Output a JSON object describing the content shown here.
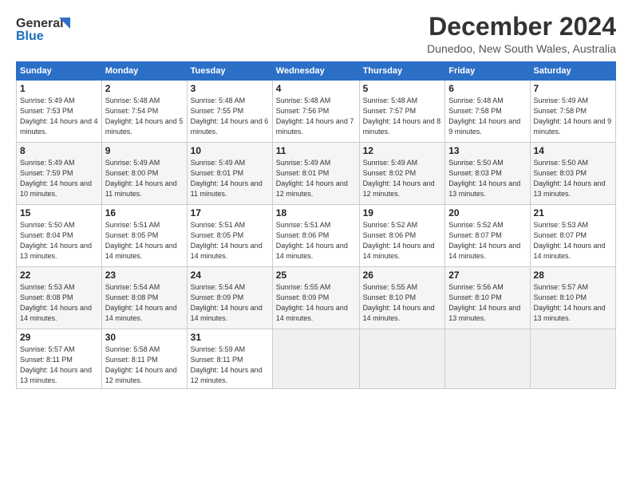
{
  "logo": {
    "line1": "General",
    "line2": "Blue"
  },
  "title": "December 2024",
  "location": "Dunedoo, New South Wales, Australia",
  "days_header": [
    "Sunday",
    "Monday",
    "Tuesday",
    "Wednesday",
    "Thursday",
    "Friday",
    "Saturday"
  ],
  "weeks": [
    [
      {
        "day": "1",
        "sunrise": "5:49 AM",
        "sunset": "7:53 PM",
        "daylight": "14 hours and 4 minutes."
      },
      {
        "day": "2",
        "sunrise": "5:48 AM",
        "sunset": "7:54 PM",
        "daylight": "14 hours and 5 minutes."
      },
      {
        "day": "3",
        "sunrise": "5:48 AM",
        "sunset": "7:55 PM",
        "daylight": "14 hours and 6 minutes."
      },
      {
        "day": "4",
        "sunrise": "5:48 AM",
        "sunset": "7:56 PM",
        "daylight": "14 hours and 7 minutes."
      },
      {
        "day": "5",
        "sunrise": "5:48 AM",
        "sunset": "7:57 PM",
        "daylight": "14 hours and 8 minutes."
      },
      {
        "day": "6",
        "sunrise": "5:48 AM",
        "sunset": "7:58 PM",
        "daylight": "14 hours and 9 minutes."
      },
      {
        "day": "7",
        "sunrise": "5:49 AM",
        "sunset": "7:58 PM",
        "daylight": "14 hours and 9 minutes."
      }
    ],
    [
      {
        "day": "8",
        "sunrise": "5:49 AM",
        "sunset": "7:59 PM",
        "daylight": "14 hours and 10 minutes."
      },
      {
        "day": "9",
        "sunrise": "5:49 AM",
        "sunset": "8:00 PM",
        "daylight": "14 hours and 11 minutes."
      },
      {
        "day": "10",
        "sunrise": "5:49 AM",
        "sunset": "8:01 PM",
        "daylight": "14 hours and 11 minutes."
      },
      {
        "day": "11",
        "sunrise": "5:49 AM",
        "sunset": "8:01 PM",
        "daylight": "14 hours and 12 minutes."
      },
      {
        "day": "12",
        "sunrise": "5:49 AM",
        "sunset": "8:02 PM",
        "daylight": "14 hours and 12 minutes."
      },
      {
        "day": "13",
        "sunrise": "5:50 AM",
        "sunset": "8:03 PM",
        "daylight": "14 hours and 13 minutes."
      },
      {
        "day": "14",
        "sunrise": "5:50 AM",
        "sunset": "8:03 PM",
        "daylight": "14 hours and 13 minutes."
      }
    ],
    [
      {
        "day": "15",
        "sunrise": "5:50 AM",
        "sunset": "8:04 PM",
        "daylight": "14 hours and 13 minutes."
      },
      {
        "day": "16",
        "sunrise": "5:51 AM",
        "sunset": "8:05 PM",
        "daylight": "14 hours and 14 minutes."
      },
      {
        "day": "17",
        "sunrise": "5:51 AM",
        "sunset": "8:05 PM",
        "daylight": "14 hours and 14 minutes."
      },
      {
        "day": "18",
        "sunrise": "5:51 AM",
        "sunset": "8:06 PM",
        "daylight": "14 hours and 14 minutes."
      },
      {
        "day": "19",
        "sunrise": "5:52 AM",
        "sunset": "8:06 PM",
        "daylight": "14 hours and 14 minutes."
      },
      {
        "day": "20",
        "sunrise": "5:52 AM",
        "sunset": "8:07 PM",
        "daylight": "14 hours and 14 minutes."
      },
      {
        "day": "21",
        "sunrise": "5:53 AM",
        "sunset": "8:07 PM",
        "daylight": "14 hours and 14 minutes."
      }
    ],
    [
      {
        "day": "22",
        "sunrise": "5:53 AM",
        "sunset": "8:08 PM",
        "daylight": "14 hours and 14 minutes."
      },
      {
        "day": "23",
        "sunrise": "5:54 AM",
        "sunset": "8:08 PM",
        "daylight": "14 hours and 14 minutes."
      },
      {
        "day": "24",
        "sunrise": "5:54 AM",
        "sunset": "8:09 PM",
        "daylight": "14 hours and 14 minutes."
      },
      {
        "day": "25",
        "sunrise": "5:55 AM",
        "sunset": "8:09 PM",
        "daylight": "14 hours and 14 minutes."
      },
      {
        "day": "26",
        "sunrise": "5:55 AM",
        "sunset": "8:10 PM",
        "daylight": "14 hours and 14 minutes."
      },
      {
        "day": "27",
        "sunrise": "5:56 AM",
        "sunset": "8:10 PM",
        "daylight": "14 hours and 13 minutes."
      },
      {
        "day": "28",
        "sunrise": "5:57 AM",
        "sunset": "8:10 PM",
        "daylight": "14 hours and 13 minutes."
      }
    ],
    [
      {
        "day": "29",
        "sunrise": "5:57 AM",
        "sunset": "8:11 PM",
        "daylight": "14 hours and 13 minutes."
      },
      {
        "day": "30",
        "sunrise": "5:58 AM",
        "sunset": "8:11 PM",
        "daylight": "14 hours and 12 minutes."
      },
      {
        "day": "31",
        "sunrise": "5:59 AM",
        "sunset": "8:11 PM",
        "daylight": "14 hours and 12 minutes."
      },
      null,
      null,
      null,
      null
    ]
  ]
}
